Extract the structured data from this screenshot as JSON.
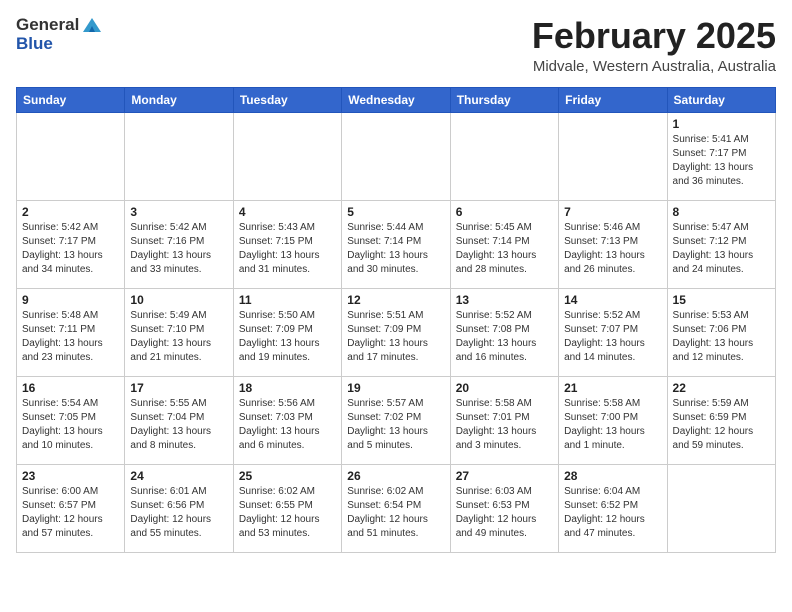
{
  "header": {
    "logo_general": "General",
    "logo_blue": "Blue",
    "month_title": "February 2025",
    "location": "Midvale, Western Australia, Australia"
  },
  "days_of_week": [
    "Sunday",
    "Monday",
    "Tuesday",
    "Wednesday",
    "Thursday",
    "Friday",
    "Saturday"
  ],
  "weeks": [
    [
      {
        "day": "",
        "info": ""
      },
      {
        "day": "",
        "info": ""
      },
      {
        "day": "",
        "info": ""
      },
      {
        "day": "",
        "info": ""
      },
      {
        "day": "",
        "info": ""
      },
      {
        "day": "",
        "info": ""
      },
      {
        "day": "1",
        "info": "Sunrise: 5:41 AM\nSunset: 7:17 PM\nDaylight: 13 hours\nand 36 minutes."
      }
    ],
    [
      {
        "day": "2",
        "info": "Sunrise: 5:42 AM\nSunset: 7:17 PM\nDaylight: 13 hours\nand 34 minutes."
      },
      {
        "day": "3",
        "info": "Sunrise: 5:42 AM\nSunset: 7:16 PM\nDaylight: 13 hours\nand 33 minutes."
      },
      {
        "day": "4",
        "info": "Sunrise: 5:43 AM\nSunset: 7:15 PM\nDaylight: 13 hours\nand 31 minutes."
      },
      {
        "day": "5",
        "info": "Sunrise: 5:44 AM\nSunset: 7:14 PM\nDaylight: 13 hours\nand 30 minutes."
      },
      {
        "day": "6",
        "info": "Sunrise: 5:45 AM\nSunset: 7:14 PM\nDaylight: 13 hours\nand 28 minutes."
      },
      {
        "day": "7",
        "info": "Sunrise: 5:46 AM\nSunset: 7:13 PM\nDaylight: 13 hours\nand 26 minutes."
      },
      {
        "day": "8",
        "info": "Sunrise: 5:47 AM\nSunset: 7:12 PM\nDaylight: 13 hours\nand 24 minutes."
      }
    ],
    [
      {
        "day": "9",
        "info": "Sunrise: 5:48 AM\nSunset: 7:11 PM\nDaylight: 13 hours\nand 23 minutes."
      },
      {
        "day": "10",
        "info": "Sunrise: 5:49 AM\nSunset: 7:10 PM\nDaylight: 13 hours\nand 21 minutes."
      },
      {
        "day": "11",
        "info": "Sunrise: 5:50 AM\nSunset: 7:09 PM\nDaylight: 13 hours\nand 19 minutes."
      },
      {
        "day": "12",
        "info": "Sunrise: 5:51 AM\nSunset: 7:09 PM\nDaylight: 13 hours\nand 17 minutes."
      },
      {
        "day": "13",
        "info": "Sunrise: 5:52 AM\nSunset: 7:08 PM\nDaylight: 13 hours\nand 16 minutes."
      },
      {
        "day": "14",
        "info": "Sunrise: 5:52 AM\nSunset: 7:07 PM\nDaylight: 13 hours\nand 14 minutes."
      },
      {
        "day": "15",
        "info": "Sunrise: 5:53 AM\nSunset: 7:06 PM\nDaylight: 13 hours\nand 12 minutes."
      }
    ],
    [
      {
        "day": "16",
        "info": "Sunrise: 5:54 AM\nSunset: 7:05 PM\nDaylight: 13 hours\nand 10 minutes."
      },
      {
        "day": "17",
        "info": "Sunrise: 5:55 AM\nSunset: 7:04 PM\nDaylight: 13 hours\nand 8 minutes."
      },
      {
        "day": "18",
        "info": "Sunrise: 5:56 AM\nSunset: 7:03 PM\nDaylight: 13 hours\nand 6 minutes."
      },
      {
        "day": "19",
        "info": "Sunrise: 5:57 AM\nSunset: 7:02 PM\nDaylight: 13 hours\nand 5 minutes."
      },
      {
        "day": "20",
        "info": "Sunrise: 5:58 AM\nSunset: 7:01 PM\nDaylight: 13 hours\nand 3 minutes."
      },
      {
        "day": "21",
        "info": "Sunrise: 5:58 AM\nSunset: 7:00 PM\nDaylight: 13 hours\nand 1 minute."
      },
      {
        "day": "22",
        "info": "Sunrise: 5:59 AM\nSunset: 6:59 PM\nDaylight: 12 hours\nand 59 minutes."
      }
    ],
    [
      {
        "day": "23",
        "info": "Sunrise: 6:00 AM\nSunset: 6:57 PM\nDaylight: 12 hours\nand 57 minutes."
      },
      {
        "day": "24",
        "info": "Sunrise: 6:01 AM\nSunset: 6:56 PM\nDaylight: 12 hours\nand 55 minutes."
      },
      {
        "day": "25",
        "info": "Sunrise: 6:02 AM\nSunset: 6:55 PM\nDaylight: 12 hours\nand 53 minutes."
      },
      {
        "day": "26",
        "info": "Sunrise: 6:02 AM\nSunset: 6:54 PM\nDaylight: 12 hours\nand 51 minutes."
      },
      {
        "day": "27",
        "info": "Sunrise: 6:03 AM\nSunset: 6:53 PM\nDaylight: 12 hours\nand 49 minutes."
      },
      {
        "day": "28",
        "info": "Sunrise: 6:04 AM\nSunset: 6:52 PM\nDaylight: 12 hours\nand 47 minutes."
      },
      {
        "day": "",
        "info": ""
      }
    ]
  ]
}
